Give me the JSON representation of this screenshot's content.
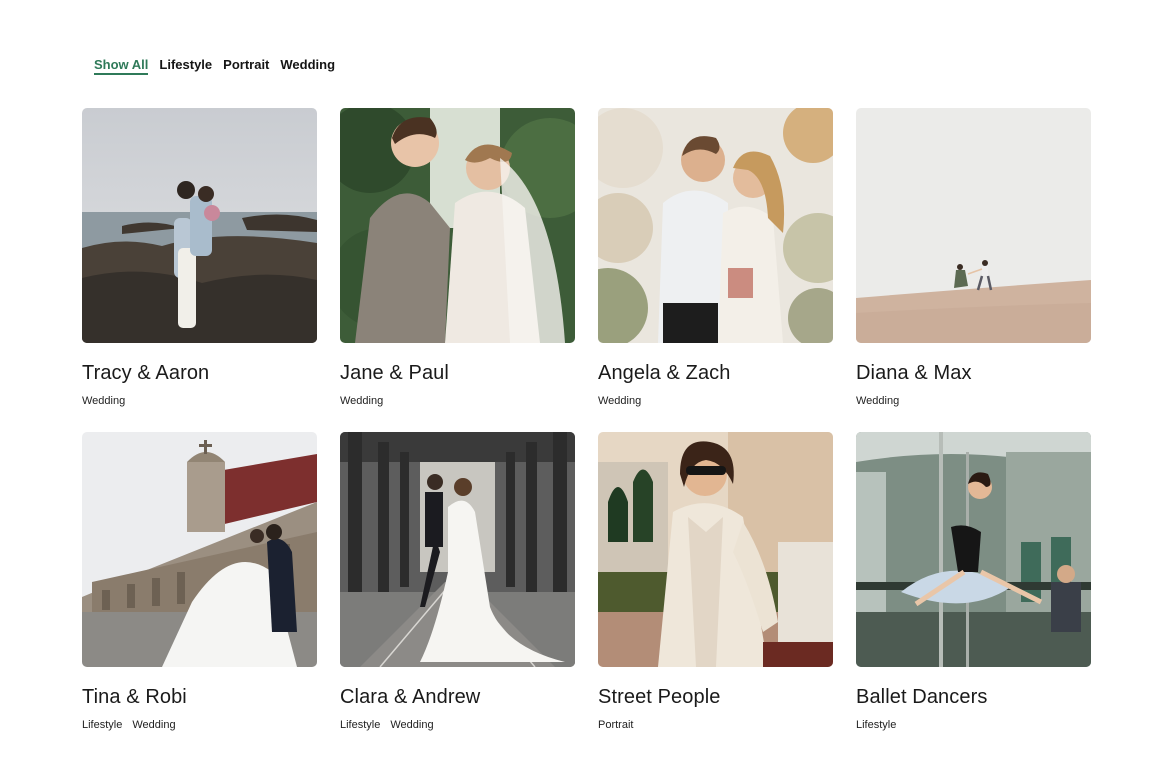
{
  "filters": [
    {
      "label": "Show All",
      "active": true
    },
    {
      "label": "Lifestyle",
      "active": false
    },
    {
      "label": "Portrait",
      "active": false
    },
    {
      "label": "Wedding",
      "active": false
    }
  ],
  "items": [
    {
      "title": "Tracy & Aaron",
      "tags": [
        "Wedding"
      ],
      "photo": "couple-on-rocky-coast-photo"
    },
    {
      "title": "Jane & Paul",
      "tags": [
        "Wedding"
      ],
      "photo": "couple-in-greenhouse-photo"
    },
    {
      "title": "Angela & Zach",
      "tags": [
        "Wedding"
      ],
      "photo": "couple-with-flowers-photo"
    },
    {
      "title": "Diana & Max",
      "tags": [
        "Wedding"
      ],
      "photo": "couple-on-dune-photo"
    },
    {
      "title": "Tina & Robi",
      "tags": [
        "Lifestyle",
        "Wedding"
      ],
      "photo": "couple-by-church-wall-photo"
    },
    {
      "title": "Clara & Andrew",
      "tags": [
        "Lifestyle",
        "Wedding"
      ],
      "photo": "couple-under-bridge-photo"
    },
    {
      "title": "Street People",
      "tags": [
        "Portrait"
      ],
      "photo": "woman-in-trench-coat-photo"
    },
    {
      "title": "Ballet Dancers",
      "tags": [
        "Lifestyle"
      ],
      "photo": "dancer-on-subway-photo"
    }
  ],
  "accent_color": "#2f7a59"
}
